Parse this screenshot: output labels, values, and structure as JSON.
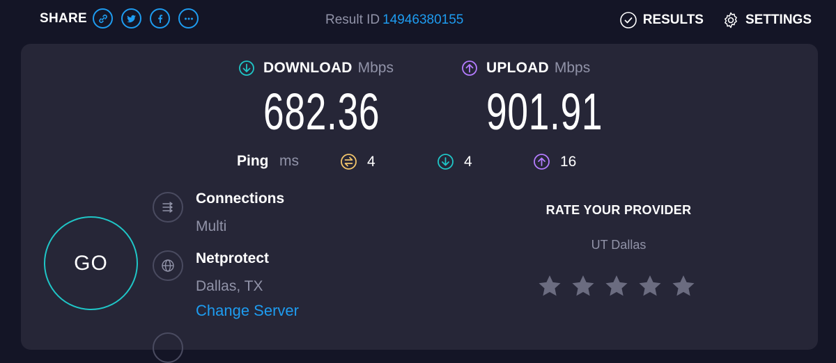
{
  "share": {
    "label": "SHARE",
    "buttons": [
      {
        "icon": "link-icon"
      },
      {
        "icon": "twitter-icon"
      },
      {
        "icon": "facebook-icon"
      },
      {
        "icon": "more-icon"
      }
    ]
  },
  "result": {
    "label": "Result ID",
    "id": "14946380155"
  },
  "nav": {
    "results_label": "RESULTS",
    "settings_label": "SETTINGS"
  },
  "download": {
    "label": "DOWNLOAD",
    "unit": "Mbps",
    "value": "682.36",
    "color": "#1fc6c7"
  },
  "upload": {
    "label": "UPLOAD",
    "unit": "Mbps",
    "value": "901.91",
    "color": "#b47cff"
  },
  "ping": {
    "label": "Ping",
    "unit": "ms",
    "idle": {
      "value": "4",
      "color": "#f3c66b"
    },
    "download": {
      "value": "4",
      "color": "#1fc6c7"
    },
    "upload": {
      "value": "16",
      "color": "#b47cff"
    }
  },
  "go": {
    "label": "GO",
    "color": "#1fc6c7"
  },
  "connections": {
    "title": "Connections",
    "value": "Multi"
  },
  "server": {
    "title": "Netprotect",
    "location": "Dallas, TX",
    "change_label": "Change Server"
  },
  "rating": {
    "title": "RATE YOUR PROVIDER",
    "provider": "UT Dallas",
    "stars_total": 5,
    "stars_filled": 0
  },
  "colors": {
    "accent": "#1e9cf0",
    "background": "#141526",
    "panel": "#262637",
    "muted": "#9193a8"
  }
}
